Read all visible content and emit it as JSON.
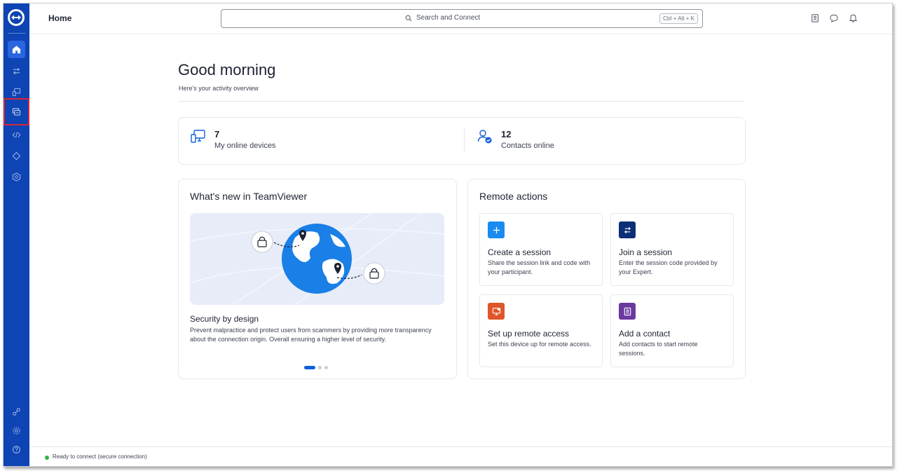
{
  "app": {
    "page_title": "Home"
  },
  "search": {
    "label": "Search and Connect",
    "shortcut": "Ctrl + Alt + K"
  },
  "sidebar": {
    "items": [
      {
        "name": "home-icon"
      },
      {
        "name": "connect-arrows-icon"
      },
      {
        "name": "remote-devices-icon"
      },
      {
        "name": "sessions-icon"
      },
      {
        "name": "code-icon"
      },
      {
        "name": "tag-icon"
      },
      {
        "name": "security-icon"
      }
    ],
    "bottom": [
      {
        "name": "integrations-icon"
      },
      {
        "name": "settings-icon"
      },
      {
        "name": "help-icon"
      }
    ]
  },
  "topbar_icons": [
    "contacts-card-icon",
    "chat-icon",
    "notification-bell-icon"
  ],
  "greeting": {
    "title": "Good morning",
    "subtitle": "Here's your activity overview"
  },
  "stats": [
    {
      "value": "7",
      "label": "My online devices"
    },
    {
      "value": "12",
      "label": "Contacts online"
    }
  ],
  "news": {
    "title": "What's new in TeamViewer",
    "section_title": "Security by design",
    "section_body": "Prevent malpractice and protect users from scammers by providing more transparency about the connection origin. Overall ensuring a higher level of security.",
    "pages": 3,
    "active_page": 1
  },
  "remote_actions": {
    "title": "Remote actions",
    "tiles": [
      {
        "title": "Create a session",
        "body": "Share the session link and code with your participant.",
        "color": "#1a8bf0"
      },
      {
        "title": "Join a session",
        "body": "Enter the session code provided by your Expert.",
        "color": "#0d2f78"
      },
      {
        "title": "Set up remote access",
        "body": "Set this device up for remote access.",
        "color": "#e0562a"
      },
      {
        "title": "Add a contact",
        "body": "Add contacts to start remote sessions.",
        "color": "#6b3aa0"
      }
    ]
  },
  "status": {
    "text": "Ready to connect (secure connection)",
    "color": "#2fb344"
  },
  "colors": {
    "rail": "#0e44b3",
    "accent": "#0e5fd8"
  }
}
